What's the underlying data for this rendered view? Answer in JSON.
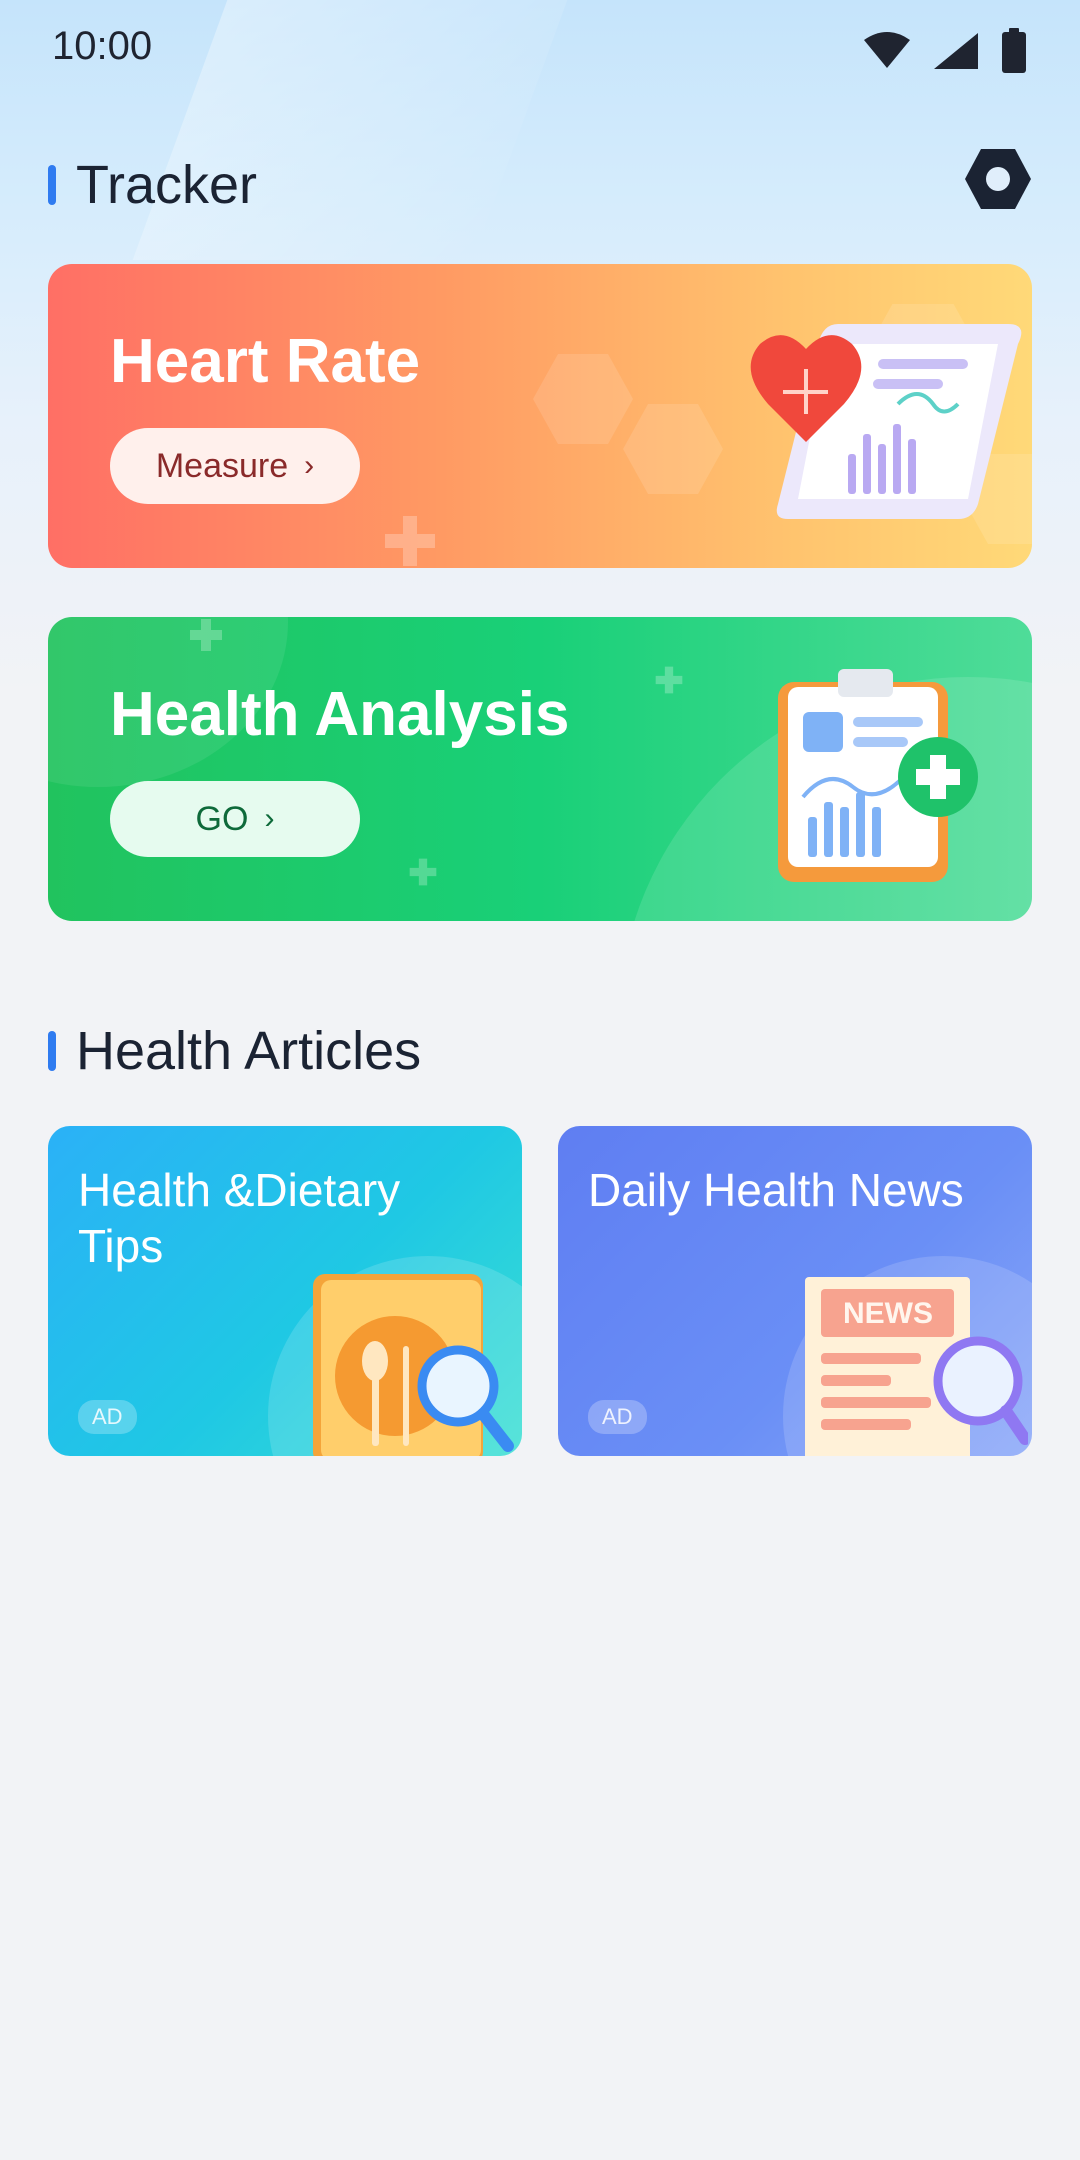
{
  "status_bar": {
    "time": "10:00"
  },
  "header": {
    "title": "Tracker"
  },
  "tracker_cards": {
    "heart_rate": {
      "title": "Heart Rate",
      "button_label": "Measure"
    },
    "health_analysis": {
      "title": "Health Analysis",
      "button_label": "GO"
    }
  },
  "articles_section": {
    "title": "Health Articles",
    "items": [
      {
        "title": "Health &Dietary Tips",
        "badge": "AD"
      },
      {
        "title": "Daily Health News",
        "badge": "AD"
      }
    ]
  },
  "news_label": "NEWS",
  "colors": {
    "accent": "#2f7bf0",
    "heart_rate_start": "#ff6f65",
    "analysis_start": "#21c35e"
  }
}
